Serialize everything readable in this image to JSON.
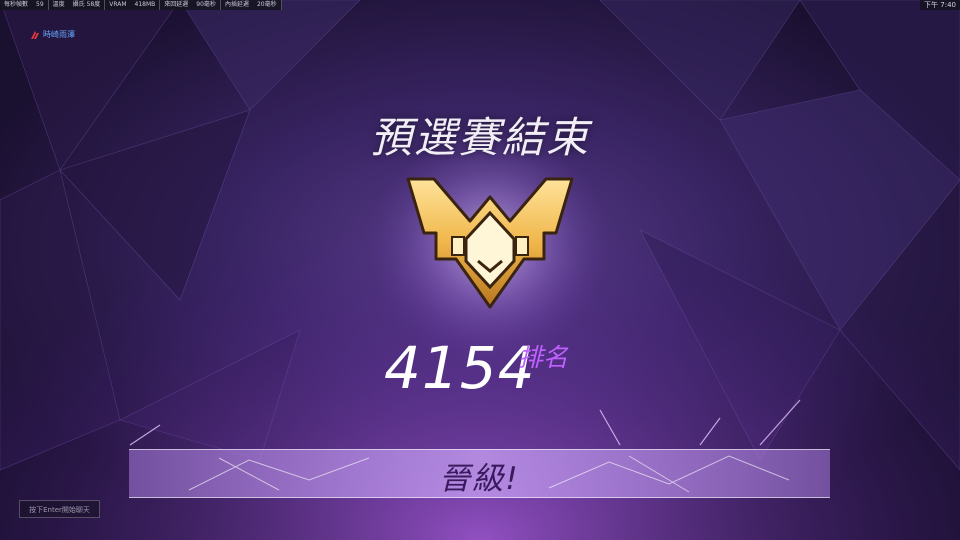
{
  "hud": {
    "items": [
      {
        "label": "每秒幀數",
        "value": "59"
      },
      {
        "label": "溫度",
        "value": "攝氏 58度"
      },
      {
        "label": "VRAM",
        "value": "418MB"
      },
      {
        "label": "來回延遲",
        "value": "90毫秒"
      },
      {
        "label": "內插延遲",
        "value": "20毫秒"
      }
    ],
    "clock": "下午 7:40"
  },
  "map": {
    "name": "時崎雨澤"
  },
  "result": {
    "title": "預選賽結束",
    "rank_number": "4154",
    "rank_label": "排名",
    "rank_tier_icon": "grandmaster-emblem-icon"
  },
  "banner": {
    "text": "晉級!"
  },
  "chat": {
    "hint": "按下Enter開始聊天"
  },
  "colors": {
    "accent": "#c061ff",
    "background": "#1d1230",
    "emblem_gold": "#f0b64a"
  }
}
